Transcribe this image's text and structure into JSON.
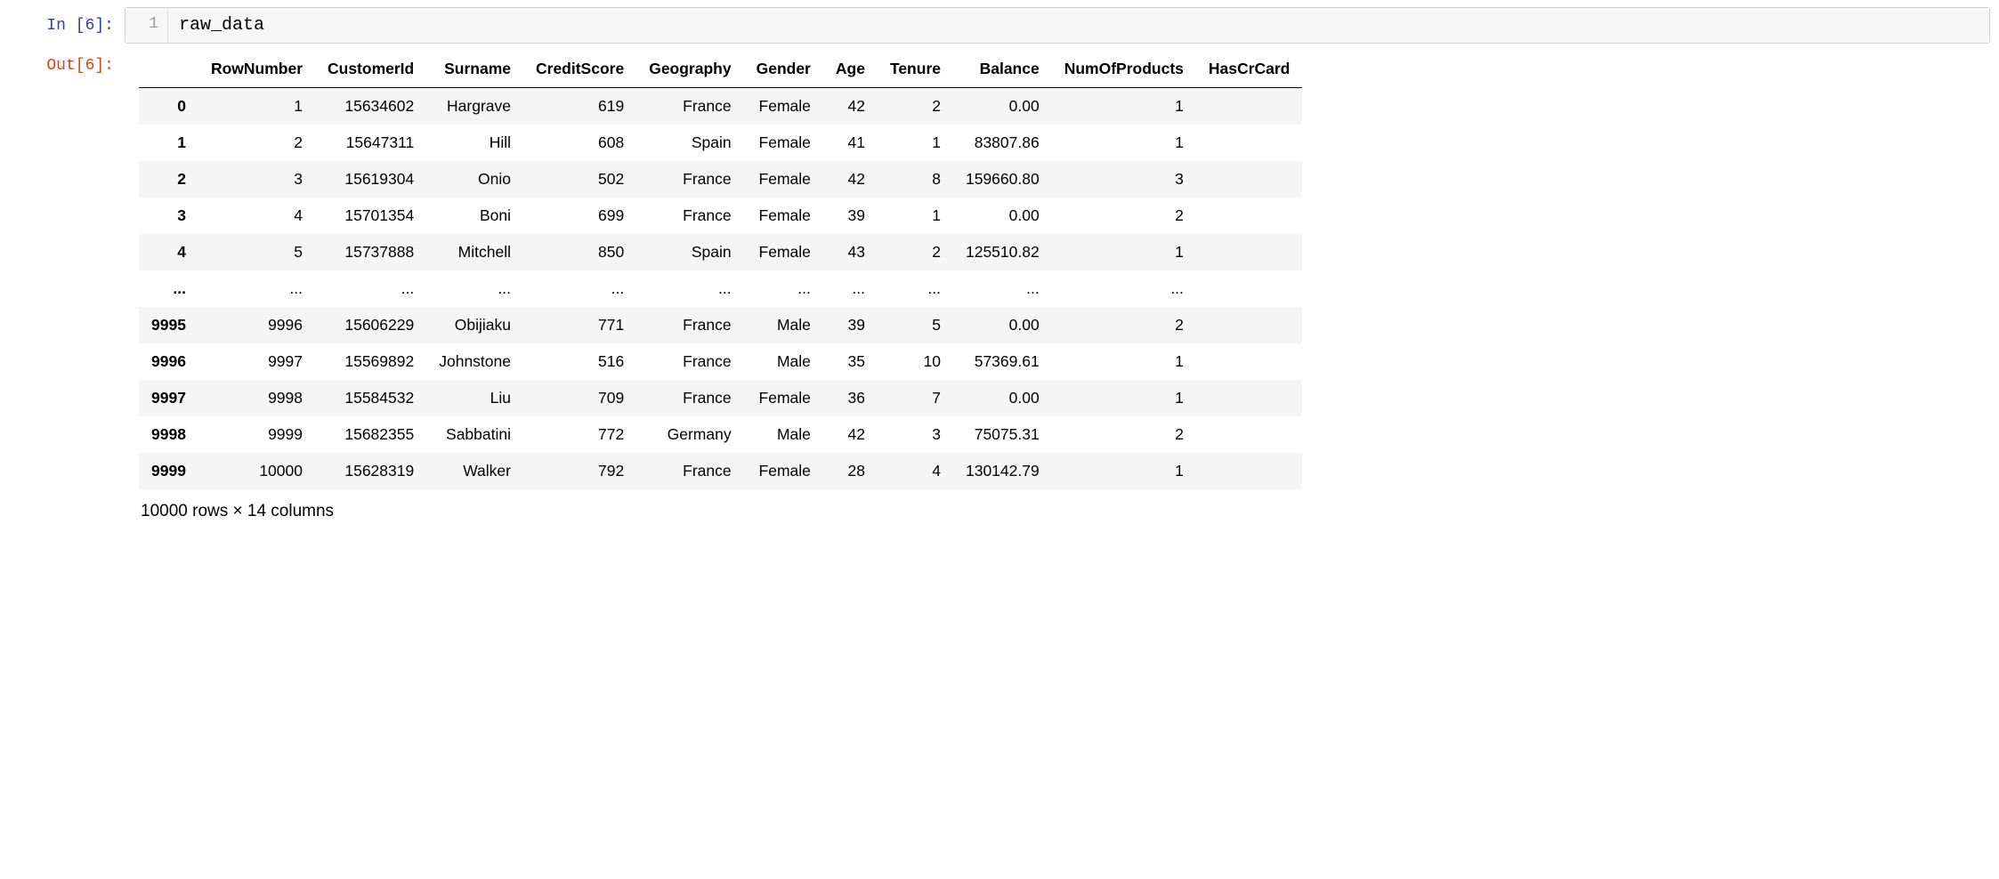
{
  "input_prompt": "In [6]:",
  "output_prompt": "Out[6]:",
  "gutter_line": "1",
  "code": "raw_data",
  "table": {
    "columns": [
      "RowNumber",
      "CustomerId",
      "Surname",
      "CreditScore",
      "Geography",
      "Gender",
      "Age",
      "Tenure",
      "Balance",
      "NumOfProducts",
      "HasCrCard"
    ],
    "rows": [
      {
        "index": "0",
        "cells": [
          "1",
          "15634602",
          "Hargrave",
          "619",
          "France",
          "Female",
          "42",
          "2",
          "0.00",
          "1",
          ""
        ]
      },
      {
        "index": "1",
        "cells": [
          "2",
          "15647311",
          "Hill",
          "608",
          "Spain",
          "Female",
          "41",
          "1",
          "83807.86",
          "1",
          ""
        ]
      },
      {
        "index": "2",
        "cells": [
          "3",
          "15619304",
          "Onio",
          "502",
          "France",
          "Female",
          "42",
          "8",
          "159660.80",
          "3",
          ""
        ]
      },
      {
        "index": "3",
        "cells": [
          "4",
          "15701354",
          "Boni",
          "699",
          "France",
          "Female",
          "39",
          "1",
          "0.00",
          "2",
          ""
        ]
      },
      {
        "index": "4",
        "cells": [
          "5",
          "15737888",
          "Mitchell",
          "850",
          "Spain",
          "Female",
          "43",
          "2",
          "125510.82",
          "1",
          ""
        ]
      },
      {
        "index": "...",
        "cells": [
          "...",
          "...",
          "...",
          "...",
          "...",
          "...",
          "...",
          "...",
          "...",
          "...",
          ""
        ]
      },
      {
        "index": "9995",
        "cells": [
          "9996",
          "15606229",
          "Obijiaku",
          "771",
          "France",
          "Male",
          "39",
          "5",
          "0.00",
          "2",
          ""
        ]
      },
      {
        "index": "9996",
        "cells": [
          "9997",
          "15569892",
          "Johnstone",
          "516",
          "France",
          "Male",
          "35",
          "10",
          "57369.61",
          "1",
          ""
        ]
      },
      {
        "index": "9997",
        "cells": [
          "9998",
          "15584532",
          "Liu",
          "709",
          "France",
          "Female",
          "36",
          "7",
          "0.00",
          "1",
          ""
        ]
      },
      {
        "index": "9998",
        "cells": [
          "9999",
          "15682355",
          "Sabbatini",
          "772",
          "Germany",
          "Male",
          "42",
          "3",
          "75075.31",
          "2",
          ""
        ]
      },
      {
        "index": "9999",
        "cells": [
          "10000",
          "15628319",
          "Walker",
          "792",
          "France",
          "Female",
          "28",
          "4",
          "130142.79",
          "1",
          ""
        ]
      }
    ]
  },
  "shape_text": "10000 rows × 14 columns"
}
